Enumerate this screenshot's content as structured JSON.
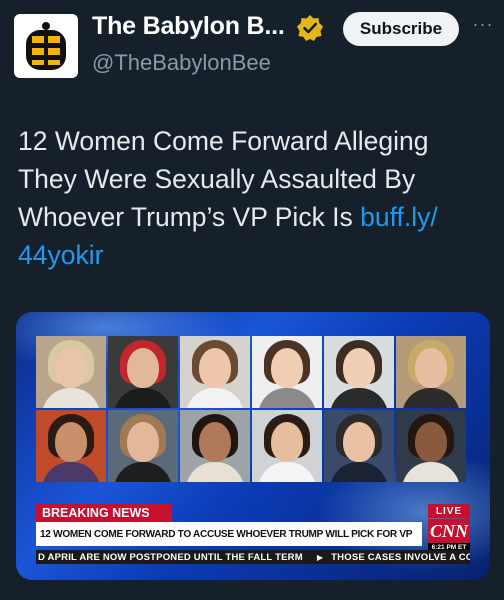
{
  "account": {
    "name": "The Babylon B...",
    "handle": "@TheBabylonBee",
    "subscribe_label": "Subscribe",
    "more_label": "···"
  },
  "tweet": {
    "text": "12 Women Come Forward Alleging They Were Sexually Assaulted By Whoever Trump’s VP Pick Is ",
    "link": "buff.ly/ 44yokir"
  },
  "media": {
    "breaking_label": "BREAKING NEWS",
    "headline": "12 WOMEN COME FORWARD TO ACCUSE WHOEVER TRUMP WILL PICK FOR VP",
    "live_label": "LIVE",
    "network_logo": "CNN",
    "time": "6:21 PM ET",
    "ticker_left": "D APRIL ARE NOW POSTPONED UNTIL THE FALL TERM",
    "ticker_right": "THOSE CASES INVOLVE A COPYR",
    "photos": [
      {
        "bg": "#b8a58c",
        "hair": "#d9c9a3",
        "skin": "#e8c4a8",
        "body": "#e9e4da"
      },
      {
        "bg": "#3a3a3a",
        "hair": "#c2272d",
        "skin": "#e3b89a",
        "body": "#1c1c1c"
      },
      {
        "bg": "#d6d3cf",
        "hair": "#6b4a34",
        "skin": "#eec7ab",
        "body": "#f2f2f2"
      },
      {
        "bg": "#efefef",
        "hair": "#4a3324",
        "skin": "#f0cdb4",
        "body": "#8a8a8a"
      },
      {
        "bg": "#d8dde0",
        "hair": "#3d2c22",
        "skin": "#f0cfb6",
        "body": "#2a2a2a"
      },
      {
        "bg": "#b39a78",
        "hair": "#c9a96a",
        "skin": "#e5bfa0",
        "body": "#2c2c2c"
      },
      {
        "bg": "#c04a2a",
        "hair": "#2a1b14",
        "skin": "#c98e6a",
        "body": "#4a3a6a"
      },
      {
        "bg": "#5a6a7a",
        "hair": "#a07a52",
        "skin": "#e3b79a",
        "body": "#1e1e1e"
      },
      {
        "bg": "#9da3a6",
        "hair": "#1f1611",
        "skin": "#b07a5a",
        "body": "#e8e0d5"
      },
      {
        "bg": "#d0d3d6",
        "hair": "#2a1d16",
        "skin": "#e6be9e",
        "body": "#f4f4f4"
      },
      {
        "bg": "#3a4a6a",
        "hair": "#2b2b2b",
        "skin": "#e8c2a2",
        "body": "#1a2233"
      },
      {
        "bg": "#2f3a4a",
        "hair": "#241712",
        "skin": "#8a5a3e",
        "body": "#e7e2da"
      }
    ]
  }
}
